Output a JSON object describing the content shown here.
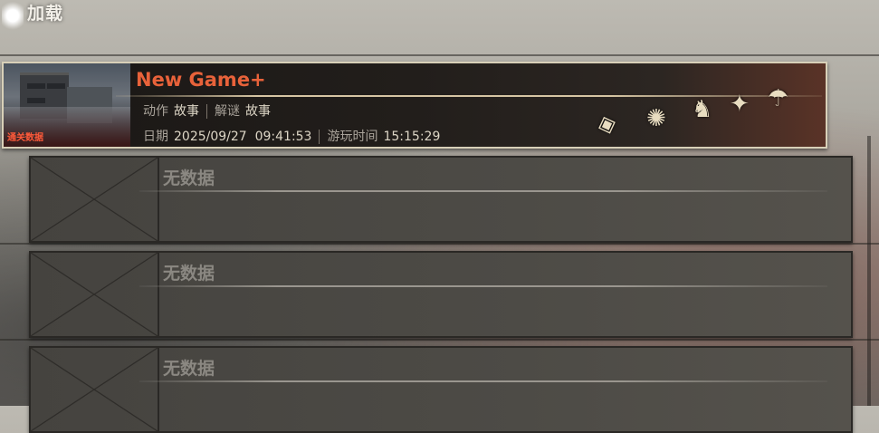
{
  "header": {
    "title": "加载"
  },
  "slots": [
    {
      "state": "filled",
      "thumbnail_label": "通关数据",
      "name": "New Game+",
      "difficulty": [
        {
          "label": "动作",
          "value": "故事"
        },
        {
          "label": "解谜",
          "value": "故事"
        }
      ],
      "date": {
        "label": "日期",
        "value": "2025/09/27  09:41:53"
      },
      "playtime": {
        "label": "游玩时间",
        "value": "15:15:29"
      },
      "charms": [
        "paper-charm-icon",
        "puffer-mask-icon",
        "fox-mask-icon",
        "bird-mask-icon",
        "umbrella-hat-icon"
      ],
      "accent_color": "#e8623a"
    },
    {
      "state": "empty",
      "label": "无数据"
    },
    {
      "state": "empty",
      "label": "无数据"
    },
    {
      "state": "empty",
      "label": "无数据"
    }
  ]
}
